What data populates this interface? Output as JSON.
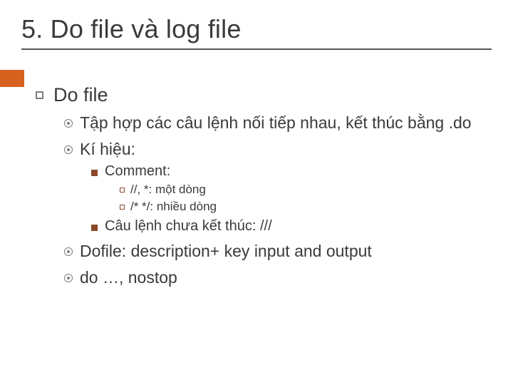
{
  "title": "5. Do file và log file",
  "lvl1": {
    "heading": "Do file"
  },
  "lvl2": {
    "item1": "Tập hợp các câu lệnh nối tiếp nhau, kết thúc bằng .do",
    "item2": "Kí hiệu:",
    "item3": "Dofile: description+ key input and output",
    "item4": "do …, nostop"
  },
  "lvl3": {
    "item1": "Comment:",
    "item2": "Câu lệnh chưa kết thúc: ///"
  },
  "lvl4": {
    "item1": "//, *: một dòng",
    "item2": "/*   */: nhiều dòng"
  }
}
